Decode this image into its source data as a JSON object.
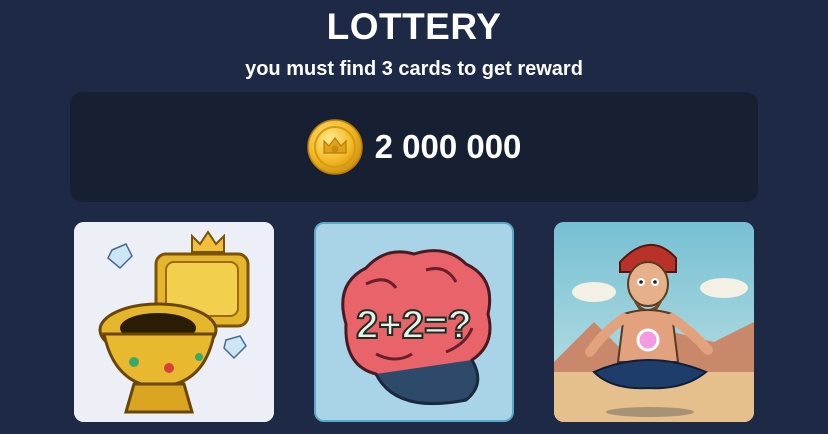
{
  "header": {
    "title": "LOTTERY",
    "subtitle": "you must find 3 cards to get reward"
  },
  "reward": {
    "icon": "gold-coin-icon",
    "amount": "2 000 000"
  },
  "cards": [
    {
      "icon": "golden-toilet-image"
    },
    {
      "icon": "brain-image",
      "text": "2+2=?"
    },
    {
      "icon": "meditating-man-image"
    }
  ]
}
